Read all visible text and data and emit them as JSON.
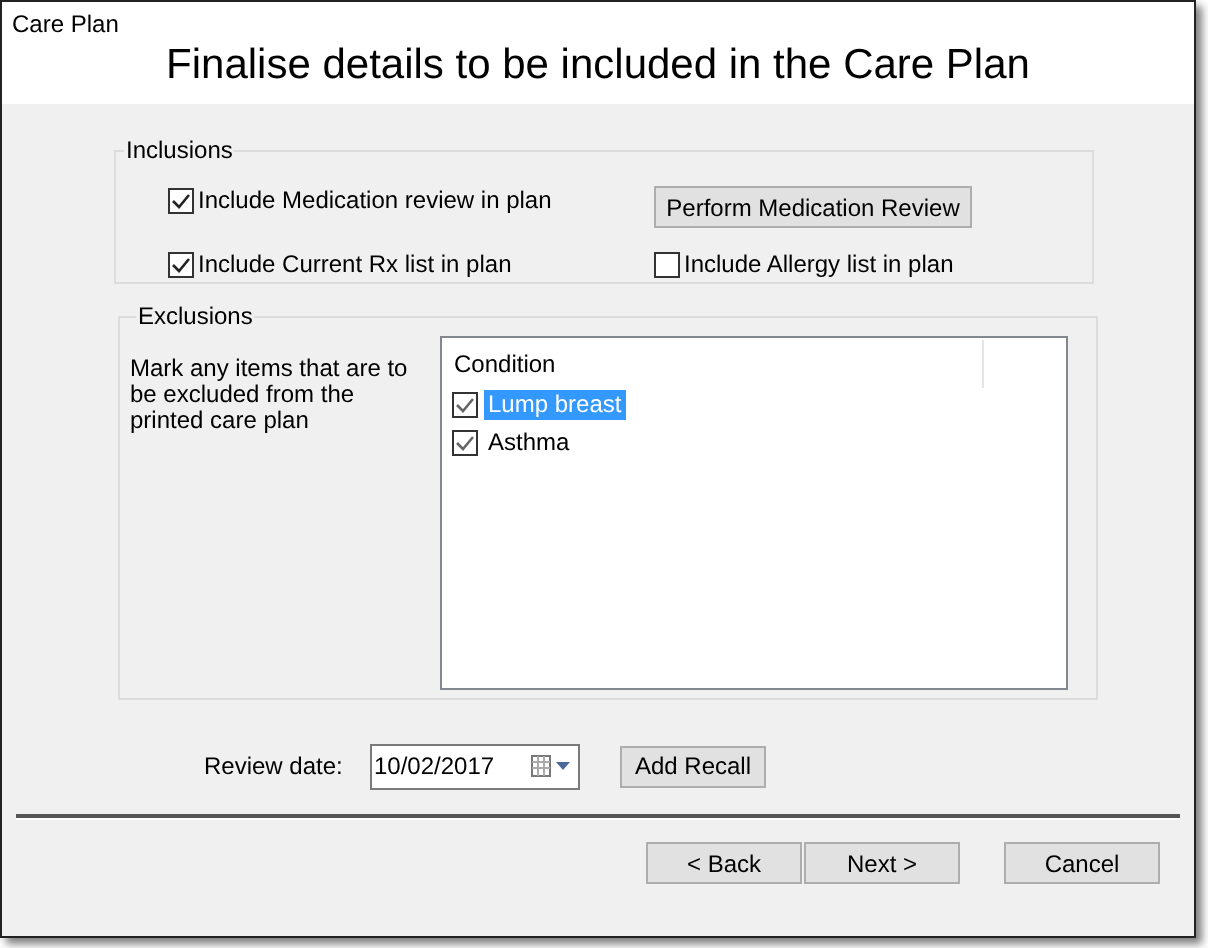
{
  "window": {
    "title": "Care Plan"
  },
  "heading": "Finalise details to be included in the Care Plan",
  "inclusions": {
    "title": "Inclusions",
    "options": [
      {
        "label": "Include Medication review in plan",
        "checked": true
      },
      {
        "label": "Include Current Rx list in plan",
        "checked": true
      },
      {
        "label": "Include Allergy list in plan",
        "checked": false
      }
    ],
    "button": "Perform Medication Review"
  },
  "exclusions": {
    "title": "Exclusions",
    "instructions": "Mark any items that are to be excluded from the printed care plan",
    "column": "Condition",
    "rows": [
      {
        "label": "Lump breast",
        "checked": true,
        "selected": true
      },
      {
        "label": "Asthma",
        "checked": true,
        "selected": false
      }
    ]
  },
  "review": {
    "label": "Review date:",
    "value": "10/02/2017",
    "button": "Add Recall"
  },
  "buttons": [
    {
      "label": "< Back"
    },
    {
      "label": "Next >"
    },
    {
      "label": "Cancel"
    }
  ]
}
